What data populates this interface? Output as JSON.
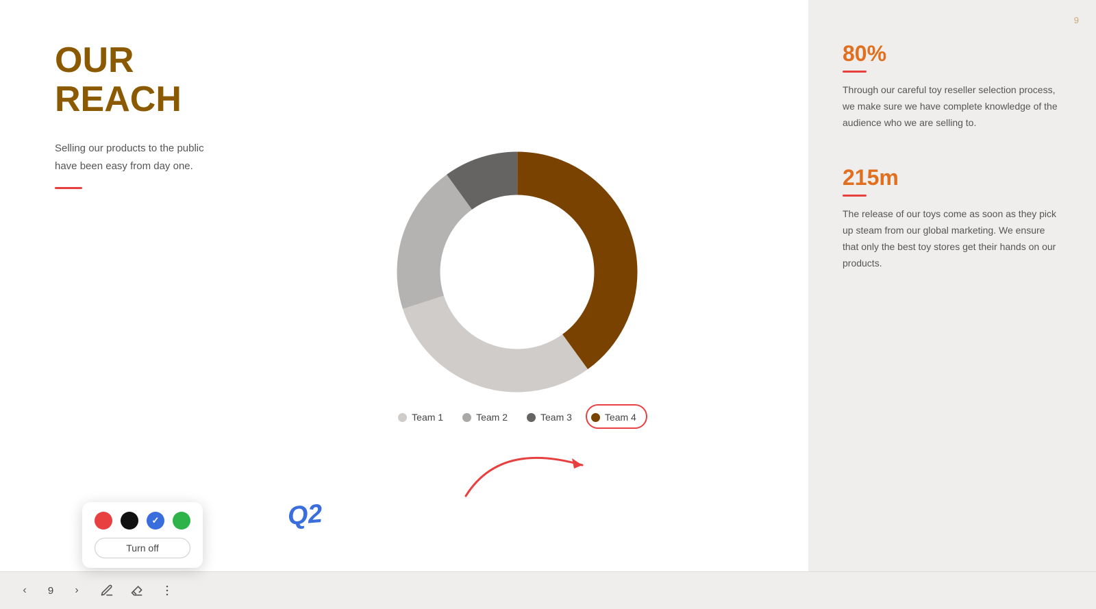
{
  "slide": {
    "title_line1": "OUR",
    "title_line2": "REACH",
    "description": "Selling our products to the public have been easy from day one.",
    "page_number": "9"
  },
  "right_panel": {
    "page_number": "9",
    "stat1": {
      "value": "80%",
      "text": "Through our careful toy reseller selection process, we make sure we have complete knowledge of the audience who we are selling to."
    },
    "stat2": {
      "value": "215m",
      "text": "The release of our toys come as soon as they pick up steam from our global marketing. We ensure that only the best toy stores get their hands on our products."
    }
  },
  "chart": {
    "q2_label": "Q2",
    "legend": [
      {
        "label": "Team 1",
        "color": "#d0ccca"
      },
      {
        "label": "Team 2",
        "color": "#aaa9a8"
      },
      {
        "label": "Team 3",
        "color": "#666462"
      },
      {
        "label": "Team 4",
        "color": "#7a4200"
      }
    ]
  },
  "toolbar": {
    "prev_label": "‹",
    "page_label": "9",
    "next_label": "›",
    "pen_icon": "✏",
    "eraser_icon": "⌫",
    "more_icon": "⋮",
    "turn_off_label": "Turn off"
  },
  "color_picker": {
    "colors": [
      {
        "name": "red",
        "hex": "#e84040",
        "selected": false
      },
      {
        "name": "black",
        "hex": "#111111",
        "selected": false
      },
      {
        "name": "blue",
        "hex": "#3a6edd",
        "selected": true
      },
      {
        "name": "green",
        "hex": "#2db34a",
        "selected": false
      }
    ]
  }
}
